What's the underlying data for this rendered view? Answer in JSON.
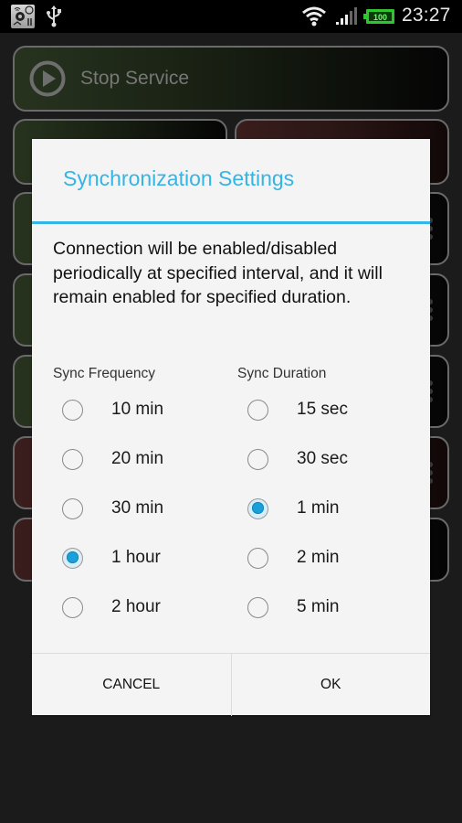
{
  "status_bar": {
    "time": "23:27",
    "battery_level": "100",
    "icons": [
      "app-notification-icon",
      "usb-icon",
      "wifi-icon",
      "signal-icon",
      "battery-icon"
    ]
  },
  "background": {
    "stop_service_label": "Stop Service",
    "stop_service_icon": "play-circle-icon"
  },
  "dialog": {
    "title": "Synchronization Settings",
    "message": "Connection will be enabled/disabled periodically at specified interval, and it will remain enabled for specified duration.",
    "frequency": {
      "label": "Sync Frequency",
      "options": [
        "10 min",
        "20 min",
        "30 min",
        "1 hour",
        "2 hour"
      ],
      "selected": "1 hour"
    },
    "duration": {
      "label": "Sync Duration",
      "options": [
        "15 sec",
        "30 sec",
        "1 min",
        "2 min",
        "5 min"
      ],
      "selected": "1 min"
    },
    "buttons": {
      "cancel": "CANCEL",
      "ok": "OK"
    },
    "accent_color": "#33b5e5"
  }
}
